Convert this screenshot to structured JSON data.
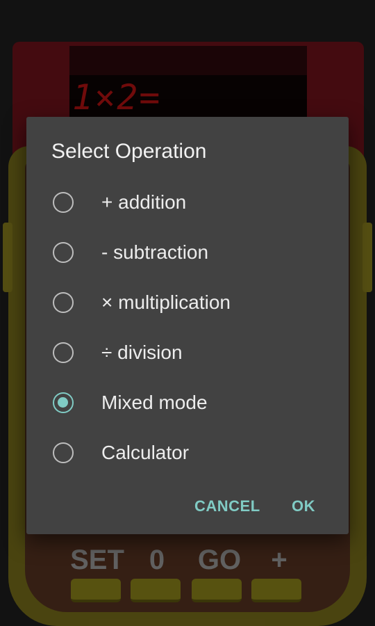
{
  "app": {
    "display_text": "1×2=",
    "keys": [
      {
        "label": "SET"
      },
      {
        "label": "0"
      },
      {
        "label": "GO"
      },
      {
        "label": "+"
      }
    ]
  },
  "dialog": {
    "title": "Select Operation",
    "options": [
      {
        "label": "+ addition",
        "selected": false
      },
      {
        "label": "- subtraction",
        "selected": false
      },
      {
        "label": "× multiplication",
        "selected": false
      },
      {
        "label": "÷ division",
        "selected": false
      },
      {
        "label": "Mixed mode",
        "selected": true
      },
      {
        "label": "Calculator",
        "selected": false
      }
    ],
    "cancel_label": "CANCEL",
    "ok_label": "OK"
  },
  "colors": {
    "accent": "#80cbc4",
    "dialog_background": "#424242",
    "device_yellow": "#514a12",
    "lcd_red": "#7a0c0c"
  }
}
